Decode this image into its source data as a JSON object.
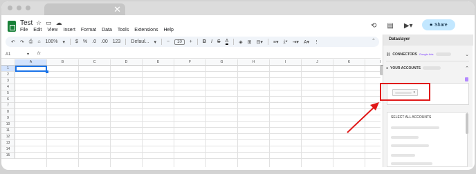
{
  "doc": {
    "title": "Test"
  },
  "menu": [
    "File",
    "Edit",
    "View",
    "Insert",
    "Format",
    "Data",
    "Tools",
    "Extensions",
    "Help"
  ],
  "share_label": "Share",
  "toolbar": {
    "zoom": "100%",
    "currency": "$",
    "percent": "%",
    "dec_dec": ".0",
    "dec_inc": ".00",
    "number_format": "123",
    "font": "Defaul...",
    "font_size": "10"
  },
  "formula": {
    "cell_ref": "A1",
    "fx": "fx"
  },
  "grid": {
    "columns": [
      "A",
      "B",
      "C",
      "D",
      "E",
      "F",
      "G",
      "H",
      "I",
      "J",
      "K",
      "L"
    ],
    "rows": [
      "1",
      "2",
      "3",
      "4",
      "5",
      "6",
      "7",
      "8",
      "9",
      "10",
      "11",
      "12",
      "13",
      "14",
      "15"
    ]
  },
  "panel": {
    "title": "Dataslayer",
    "connectors_label": "CONNECTORS",
    "connectors_sub": "Google Ads",
    "accounts_label": "YOUR ACCOUNTS",
    "chip_x": "x",
    "select_all": "SELECT ALL ACCOUNTS"
  },
  "colors": {
    "accent": "#1a73e8",
    "share_bg": "#c2e7ff",
    "highlight": "#e01818",
    "sheets_green": "#188038"
  }
}
